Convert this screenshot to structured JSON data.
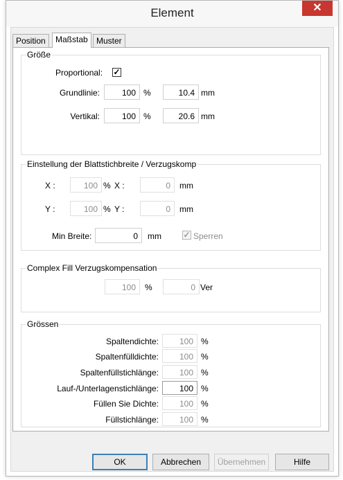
{
  "window": {
    "title": "Element"
  },
  "tabs": [
    {
      "label": "Position"
    },
    {
      "label": "Maßstab"
    },
    {
      "label": "Muster"
    }
  ],
  "groesse": {
    "title": "Größe",
    "proportional_label": "Proportional:",
    "proportional_checked": true,
    "grundlinie_label": "Grundlinie:",
    "grundlinie_percent": "100",
    "grundlinie_mm": "10.4",
    "vertikal_label": "Vertikal:",
    "vertikal_percent": "100",
    "vertikal_mm": "20.6",
    "unit_percent": "%",
    "unit_mm": "mm"
  },
  "blatt": {
    "title": "Einstellung der Blattstichbreite / Verzugskomp",
    "x_label": "X :",
    "x_percent": "100",
    "x2_label": "X :",
    "x_mm": "0",
    "y_label": "Y :",
    "y_percent": "100",
    "y2_label": "Y :",
    "y_mm": "0",
    "unit_percent": "%",
    "unit_mm": "mm",
    "min_breite_label": "Min Breite:",
    "min_breite_value": "0",
    "min_breite_unit": "mm",
    "sperren_label": "Sperren",
    "sperren_checked": true
  },
  "complex": {
    "title": "Complex Fill Verzugskompensation",
    "percent_value": "100",
    "unit_percent": "%",
    "ver_value": "0",
    "ver_unit": "Ver"
  },
  "groessen": {
    "title": "Grössen",
    "unit_percent": "%",
    "rows": [
      {
        "label": "Spaltendichte:",
        "value": "100"
      },
      {
        "label": "Spaltenfülldichte:",
        "value": "100"
      },
      {
        "label": "Spaltenfüllstichlänge:",
        "value": "100"
      },
      {
        "label": "Lauf-/Unterlagenstichlänge:",
        "value": "100"
      },
      {
        "label": "Füllen Sie Dichte:",
        "value": "100"
      },
      {
        "label": "Füllstichlänge:",
        "value": "100"
      }
    ]
  },
  "buttons": {
    "ok": "OK",
    "cancel": "Abbrechen",
    "apply": "Übernehmen",
    "help": "Hilfe"
  },
  "icons": {
    "close": "close-icon"
  },
  "colors": {
    "close_bg": "#c7372f",
    "default_button_border": "#3c7fb1"
  }
}
